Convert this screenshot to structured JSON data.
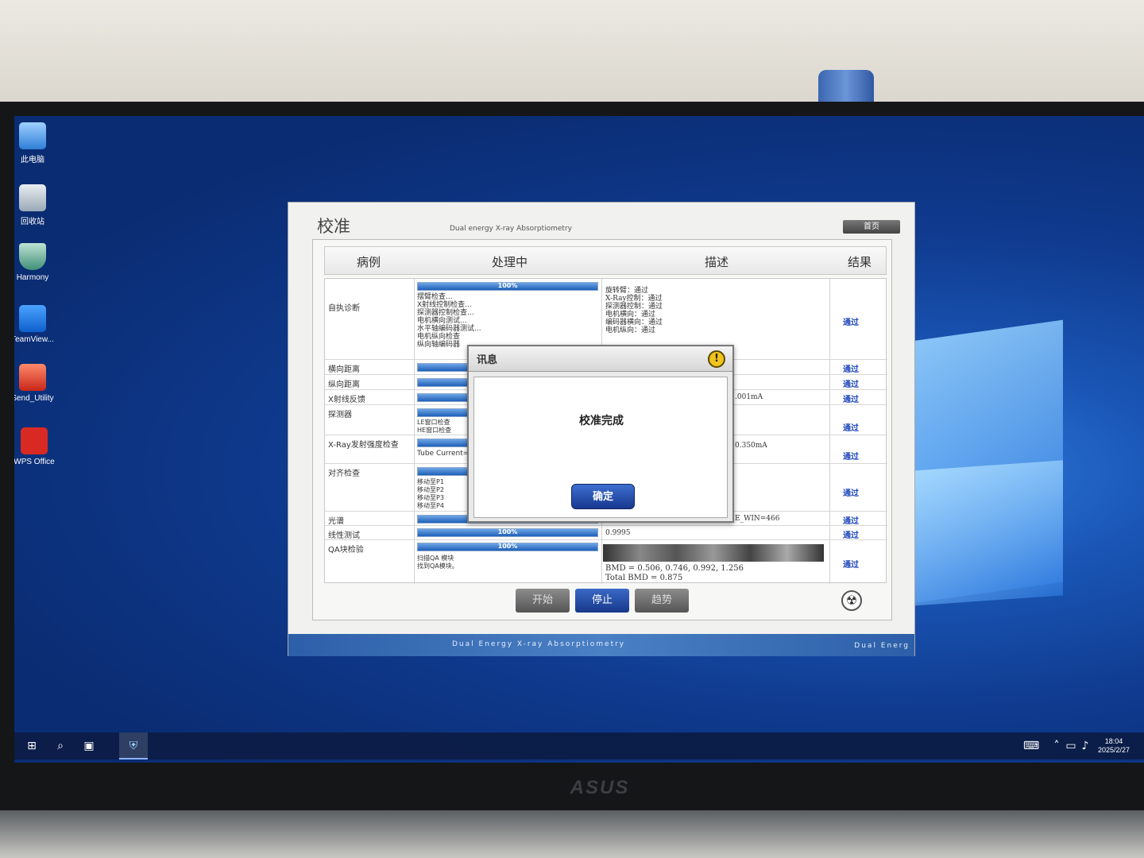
{
  "desktop": {
    "icons": [
      {
        "label": "此电脑",
        "icon": "computer-icon"
      },
      {
        "label": "回收站",
        "icon": "recycle-bin-icon"
      },
      {
        "label": "Harmony",
        "icon": "shield-icon"
      },
      {
        "label": "TeamView...",
        "icon": "teamviewer-icon"
      },
      {
        "label": "Send_Utility",
        "icon": "wifi-icon"
      },
      {
        "label": "WPS Office",
        "icon": "wps-icon"
      }
    ]
  },
  "taskbar": {
    "time": "18:04",
    "date": "2025/2/27"
  },
  "monitor": {
    "brand": "ASUS"
  },
  "app": {
    "title": "校准",
    "subtitle": "Dual energy X-ray Absorptiometry",
    "home_label": "首页",
    "columns": [
      "病例",
      "处理中",
      "描述",
      "结果"
    ],
    "rows": [
      {
        "name": "自执诊断",
        "progress": "100%",
        "process_lines": [
          "摆臂检查...",
          "X射线控制检查...",
          "探测器控制检查...",
          "电机横向测试...",
          "水平轴编码器测试...",
          "电机纵向检查",
          "纵向轴编码器"
        ],
        "desc_lines": [
          "旋转臂：通过",
          "X-Ray控制：通过",
          "探测器控制：通过",
          "电机横向：通过",
          "编码器横向：通过",
          "电机纵向：通过"
        ],
        "result": "通过"
      },
      {
        "name": "横向距离",
        "process_lines": [],
        "desc_lines": [],
        "result": "通过"
      },
      {
        "name": "纵向距离",
        "process_lines": [],
        "desc_lines": [],
        "result": "通过"
      },
      {
        "name": "X射线反馈",
        "process_lines": [],
        "desc_lines": [
          ".001mA"
        ],
        "result": "通过"
      },
      {
        "name": "探测器",
        "process_lines": [
          "LE窗口检查",
          "HE窗口检查"
        ],
        "desc_lines": [],
        "result": "通过"
      },
      {
        "name": "X-Ray发射强度检查",
        "process_lines": [
          "Tube Current="
        ],
        "desc_lines": [
          "0.350mA"
        ],
        "result": "通过"
      },
      {
        "name": "对齐检查",
        "process_lines": [
          "移动至P1",
          "移动至P2",
          "移动至P3",
          "移动至P4"
        ],
        "desc_lines": [],
        "result": "通过"
      },
      {
        "name": "光谱",
        "process_lines": [],
        "desc_lines": [
          "E_WIN=466"
        ],
        "result": "通过"
      },
      {
        "name": "线性测试",
        "progress": "100%",
        "process_lines": [],
        "desc_lines": [
          "0.9995"
        ],
        "result": "通过"
      },
      {
        "name": "QA块检验",
        "progress": "100%",
        "process_lines": [
          "扫描QA 模块",
          "找到QA模块。"
        ],
        "desc_lines": [
          "BMD = 0.506, 0.746, 0.992, 1.256",
          "Total BMD = 0.875"
        ],
        "result": "通过"
      }
    ],
    "buttons": {
      "start": "开始",
      "stop": "停止",
      "trend": "趋势"
    },
    "footer": "Dual Energy X-ray Absorptiometry",
    "footer_right": "Dual Energ"
  },
  "dialog": {
    "title": "讯息",
    "message": "校准完成",
    "ok_label": "确定"
  }
}
